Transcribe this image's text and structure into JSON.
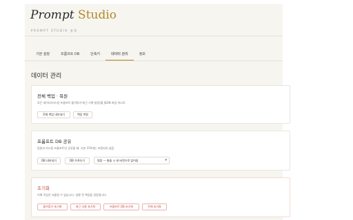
{
  "app": {
    "brand_prompt": "Prompt",
    "brand_studio": "Studio",
    "subtitle": "PROMPT STUDIO 설정"
  },
  "tabs": [
    {
      "label": "기본 설정"
    },
    {
      "label": "프롬프트 DB"
    },
    {
      "label": "단축키"
    },
    {
      "label": "데이터 관리"
    },
    {
      "label": "정보"
    }
  ],
  "active_tab": "데이터 관리",
  "section_title": "데이터 관리",
  "backup": {
    "title": "전체 백업 · 복원",
    "desc": "모든 데이터(커스텀 프롬프트·즐겨찾기·최근 기록·설정)를 JSON 파일 하나로.",
    "export_label": "전체 백업 내보내기",
    "restore_label": "백업 복원"
  },
  "share": {
    "title": "프롬프트 DB 공유",
    "desc": "팀원과 커스텀 프롬프트만 공유할 때. 기본 379개는 포함되지 않음.",
    "export_label": "DB 내보내기",
    "import_label": "DB 가져오기",
    "merge_select": "병합 — 충돌 시 새 버전으로 덮어씀"
  },
  "reset": {
    "title": "초기화",
    "desc": "이해 작업은 되돌릴 수 없습니다. 실행 전 백업을 권장합니다.",
    "btn_favorites": "즐겨찾기 초기화",
    "btn_recent": "최근 사용 초기화",
    "btn_db": "프롬프트 DB 초기화",
    "btn_all": "전체 초기화"
  },
  "colors": {
    "accent": "#b38722",
    "danger": "#c2473c",
    "panel_bg": "#f6f5f0"
  }
}
